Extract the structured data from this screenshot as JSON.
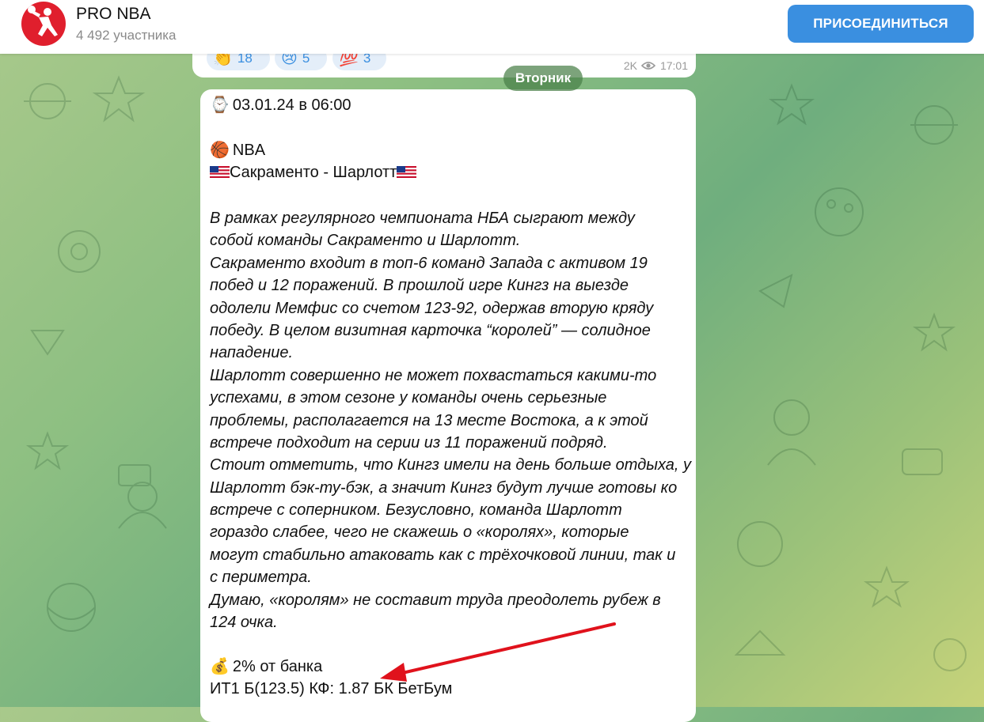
{
  "header": {
    "title": "PRO NBA",
    "subtitle": "4 492 участника",
    "join_label": "ПРИСОЕДИНИТЬСЯ"
  },
  "prev_message": {
    "reactions": [
      {
        "emoji": "👏",
        "count": "18"
      },
      {
        "emoji": "😢",
        "count": "5"
      },
      {
        "emoji": "💯",
        "count": "3"
      }
    ],
    "views": "2K",
    "time": "17:01"
  },
  "date_pill": "Вторник",
  "post": {
    "datetime_emoji": "⌚",
    "datetime": "03.01.24 в 06:00",
    "league_emoji": "🏀",
    "league": "NBA",
    "matchup": "Сакраменто - Шарлотт",
    "analysis_lines": [
      "В рамках регулярного чемпионата НБА сыграют между",
      "собой команды Сакраменто и Шарлотт.",
      "Сакраменто входит в топ-6 команд Запада с активом 19",
      "побед и 12 поражений. В прошлой игре Кингз на выезде",
      "одолели Мемфис со счетом 123-92, одержав вторую кряду",
      "победу. В целом визитная карточка “королей” — солидное",
      "нападение.",
      "Шарлотт совершенно не может похвастаться какими-то",
      "успехами, в этом сезоне у команды очень серьезные",
      "проблемы, располагается на 13 месте Востока, а к этой",
      "встрече подходит на серии из 11 поражений подряд.",
      "Стоит отметить, что Кингз имели на день больше отдыха, у",
      "Шарлотт бэк-ту-бэк, а значит Кингз будут лучше готовы ко",
      "встрече с соперником. Безусловно, команда Шарлотт",
      "гораздо слабее, чего не скажешь о «королях», которые",
      "могут стабильно атаковать как с трёхочковой линии, так и",
      "с периметра.",
      "Думаю, «королям» не составит труда преодолеть рубеж в",
      "124 очка."
    ],
    "stake_emoji": "💰",
    "stake": "2% от банка",
    "bet": "ИТ1 Б(123.5) КФ: 1.87 БК БетБум"
  },
  "colors": {
    "join_button": "#3a8fe0",
    "reaction_text": "#3a8fe0",
    "avatar_bg": "#e01f2d",
    "annotation_arrow": "#e0121c"
  }
}
